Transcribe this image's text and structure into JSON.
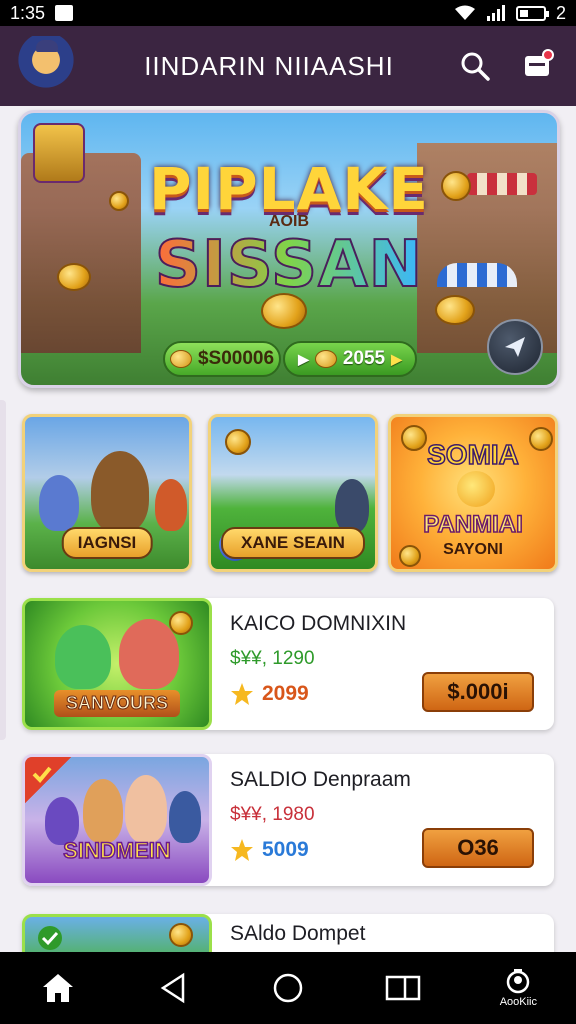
{
  "status_bar": {
    "time": "1:35",
    "battery": "2"
  },
  "header": {
    "title": "IINDARIN NIIAASHI"
  },
  "hero": {
    "title_line1": "PIPLAKE",
    "title_sub": "AOIB",
    "title_line2": "SISSAN",
    "pill_left": "$S00006",
    "pill_right": "2055"
  },
  "tiles": [
    {
      "label": "IAGNSI"
    },
    {
      "label": "XANE SEAIN"
    },
    {
      "title": "SOMIA",
      "subtitle": "PANMIAI",
      "caption": "SAYONI"
    }
  ],
  "list": [
    {
      "thumb_label": "SANVOURS",
      "title": "KAICO DOMNIXIN",
      "subtitle": "$¥¥, 1290",
      "stat": "2099",
      "button": "$.000i",
      "subtitle_color": "#2e9a2a",
      "stat_color": "#d8561a"
    },
    {
      "thumb_label": "SINDMEIN",
      "title": "SALDIO Denpraam",
      "subtitle": "$¥¥, 1980",
      "stat": "5009",
      "button": "O36",
      "subtitle_color": "#c8303a",
      "stat_color": "#2a7ad8"
    },
    {
      "title": "SAldo Dompet"
    }
  ],
  "nav": {
    "home_icon": "home-icon",
    "back_icon": "back-icon",
    "recents_icon": "recents-icon",
    "account_label": "AooKiic"
  }
}
